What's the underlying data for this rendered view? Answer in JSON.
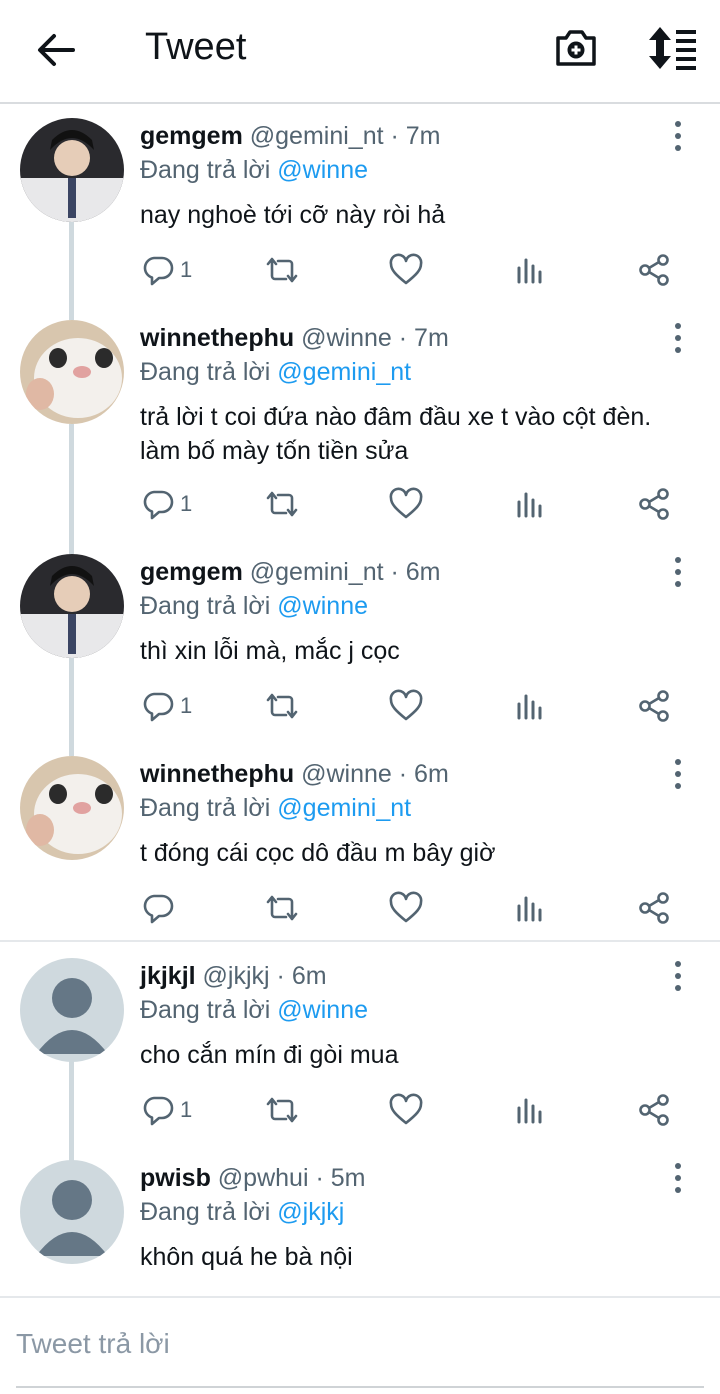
{
  "header": {
    "title": "Tweet",
    "back_icon": "arrow-left-icon",
    "camera_icon": "camera-plus-icon",
    "sort_icon": "sort-list-icon"
  },
  "tweets": [
    {
      "name": "gemgem",
      "handle": "@gemini_nt",
      "time": "· 7m",
      "reply_prefix": "Đang trả lời",
      "reply_to": "@winne",
      "text": "nay nghoè tới cỡ này ròi hả",
      "reply_count": "1",
      "avatar": "photo-boy"
    },
    {
      "name": "winnethephu",
      "handle": "@winne",
      "time": "· 7m",
      "reply_prefix": "Đang trả lời",
      "reply_to": "@gemini_nt",
      "text": "trả lời t coi đứa nào đâm đầu xe t vào cột đèn. làm bố mày tốn tiền sửa",
      "reply_count": "1",
      "avatar": "photo-cat"
    },
    {
      "name": "gemgem",
      "handle": "@gemini_nt",
      "time": "· 6m",
      "reply_prefix": "Đang trả lời",
      "reply_to": "@winne",
      "text": "thì xin lỗi mà, mắc j cọc",
      "reply_count": "1",
      "avatar": "photo-boy"
    },
    {
      "name": "winnethephu",
      "handle": "@winne",
      "time": "· 6m",
      "reply_prefix": "Đang trả lời",
      "reply_to": "@gemini_nt",
      "text": "t đóng cái cọc dô đầu m bây giờ",
      "reply_count": "",
      "avatar": "photo-cat"
    },
    {
      "name": "jkjkjl",
      "handle": "@jkjkj",
      "time": "· 6m",
      "reply_prefix": "Đang trả lời",
      "reply_to": "@winne",
      "text": "cho cắn mín đi gòi mua",
      "reply_count": "1",
      "avatar": "default"
    },
    {
      "name": "pwisb",
      "handle": "@pwhui",
      "time": "· 5m",
      "reply_prefix": "Đang trả lời",
      "reply_to": "@jkjkj",
      "text": "khôn quá he bà nội",
      "reply_count": "",
      "avatar": "default"
    }
  ],
  "action_icons": [
    "reply-icon",
    "retweet-icon",
    "like-icon",
    "analytics-icon",
    "share-icon"
  ],
  "compose": {
    "placeholder": "Tweet trả lời",
    "value": ""
  },
  "colors": {
    "link": "#1d9bf0",
    "secondary_text": "#536471",
    "primary_text": "#0f1419",
    "thread_line": "#cfd9de"
  }
}
